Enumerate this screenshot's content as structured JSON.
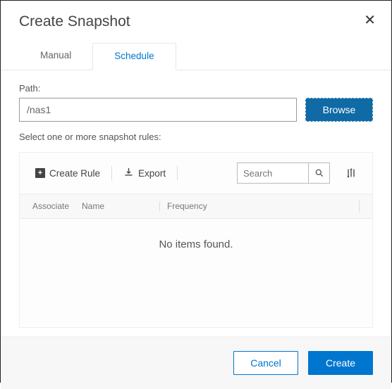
{
  "dialog": {
    "title": "Create Snapshot"
  },
  "tabs": {
    "manual": "Manual",
    "schedule": "Schedule"
  },
  "path": {
    "label": "Path:",
    "value": "/nas1",
    "browse": "Browse"
  },
  "rules": {
    "hint": "Select one or more snapshot rules:",
    "create": "Create Rule",
    "export": "Export",
    "search_placeholder": "Search",
    "columns": {
      "associate": "Associate",
      "name": "Name",
      "frequency": "Frequency"
    },
    "empty": "No items found."
  },
  "footer": {
    "cancel": "Cancel",
    "create": "Create"
  }
}
